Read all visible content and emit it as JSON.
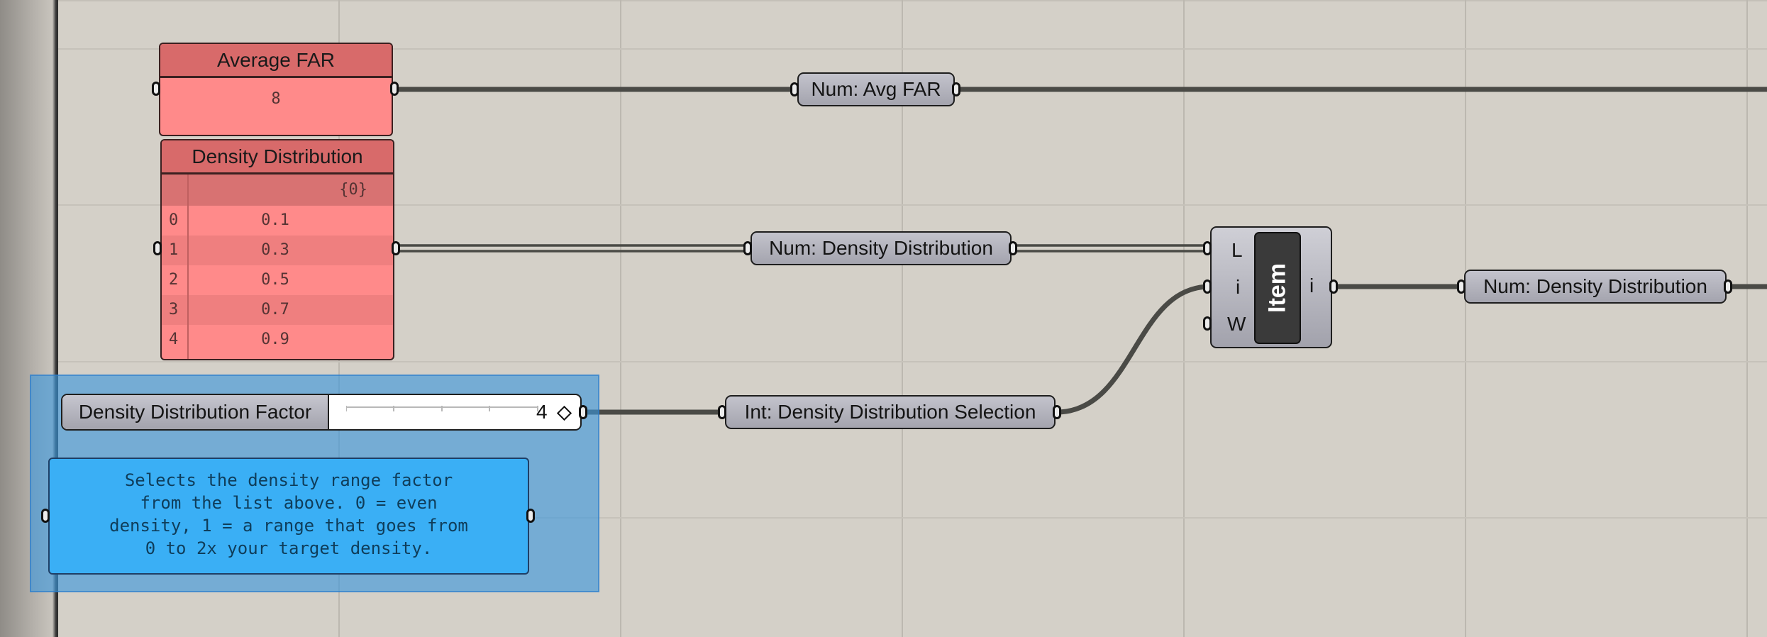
{
  "canvas": {
    "background": "#d4d0c8"
  },
  "panels": {
    "average_far": {
      "title": "Average FAR",
      "value": "8"
    },
    "density_distribution": {
      "title": "Density Distribution",
      "path": "{0}",
      "items": [
        {
          "index": "0",
          "value": "0.1"
        },
        {
          "index": "1",
          "value": "0.3"
        },
        {
          "index": "2",
          "value": "0.5"
        },
        {
          "index": "3",
          "value": "0.7"
        },
        {
          "index": "4",
          "value": "0.9"
        }
      ]
    }
  },
  "params": {
    "avg_far": "Num: Avg FAR",
    "density_distribution_in": "Num: Density Distribution",
    "density_selection": "Int: Density Distribution Selection",
    "density_distribution_out": "Num: Density Distribution"
  },
  "slider": {
    "name": "Density Distribution Factor",
    "value": "4"
  },
  "note": {
    "text": "Selects the density range factor\nfrom the list above. 0 = even\ndensity, 1 = a range that goes from\n0 to 2x your target density."
  },
  "item_component": {
    "label": "Item",
    "inputs": [
      "L",
      "i",
      "W"
    ],
    "output": "i"
  },
  "colors": {
    "panel": "#ff8a8a",
    "panel_header": "#d86a6a",
    "group": "#3a96dc",
    "note": "#3aaff5",
    "param": "#a8a8b2",
    "wire": "#4a4a46"
  }
}
